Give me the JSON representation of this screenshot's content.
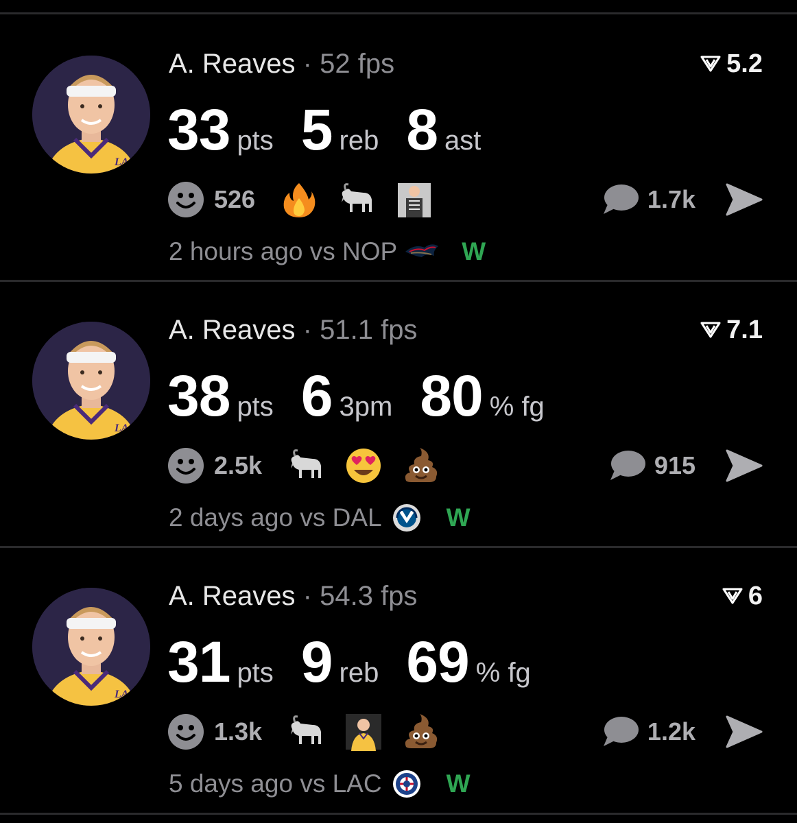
{
  "colors": {
    "background": "#000000",
    "divider": "#2a2a2c",
    "muted_text": "#8e8e93",
    "win_green": "#2fa653",
    "lakers_gold": "#f5c242",
    "lakers_purple": "#4a2a7a"
  },
  "cards": [
    {
      "player": "A. Reaves",
      "separator": "·",
      "fps": "52 fps",
      "rating": "5.2",
      "stats": [
        {
          "value": "33",
          "unit": "pts"
        },
        {
          "value": "5",
          "unit": "reb"
        },
        {
          "value": "8",
          "unit": "ast"
        }
      ],
      "reaction_count": "526",
      "reactions": [
        "fire-emoji",
        "goat-emoji",
        "xray-player-sticker"
      ],
      "comment_count": "1.7k",
      "time": "2 hours ago",
      "vs_label": "vs NOP",
      "opponent_logo": "pelicans-logo",
      "result": "W"
    },
    {
      "player": "A. Reaves",
      "separator": "·",
      "fps": "51.1 fps",
      "rating": "7.1",
      "stats": [
        {
          "value": "38",
          "unit": "pts"
        },
        {
          "value": "6",
          "unit": "3pm"
        },
        {
          "value": "80",
          "unit": "% fg"
        }
      ],
      "reaction_count": "2.5k",
      "reactions": [
        "goat-emoji",
        "heart-eyes-emoji",
        "poop-emoji"
      ],
      "comment_count": "915",
      "time": "2 days ago",
      "vs_label": "vs DAL",
      "opponent_logo": "mavericks-logo",
      "result": "W"
    },
    {
      "player": "A. Reaves",
      "separator": "·",
      "fps": "54.3 fps",
      "rating": "6",
      "stats": [
        {
          "value": "31",
          "unit": "pts"
        },
        {
          "value": "9",
          "unit": "reb"
        },
        {
          "value": "69",
          "unit": "% fg"
        }
      ],
      "reaction_count": "1.3k",
      "reactions": [
        "goat-emoji",
        "lakers-player-sticker",
        "poop-emoji"
      ],
      "comment_count": "1.2k",
      "time": "5 days ago",
      "vs_label": "vs LAC",
      "opponent_logo": "clippers-logo",
      "result": "W"
    }
  ]
}
